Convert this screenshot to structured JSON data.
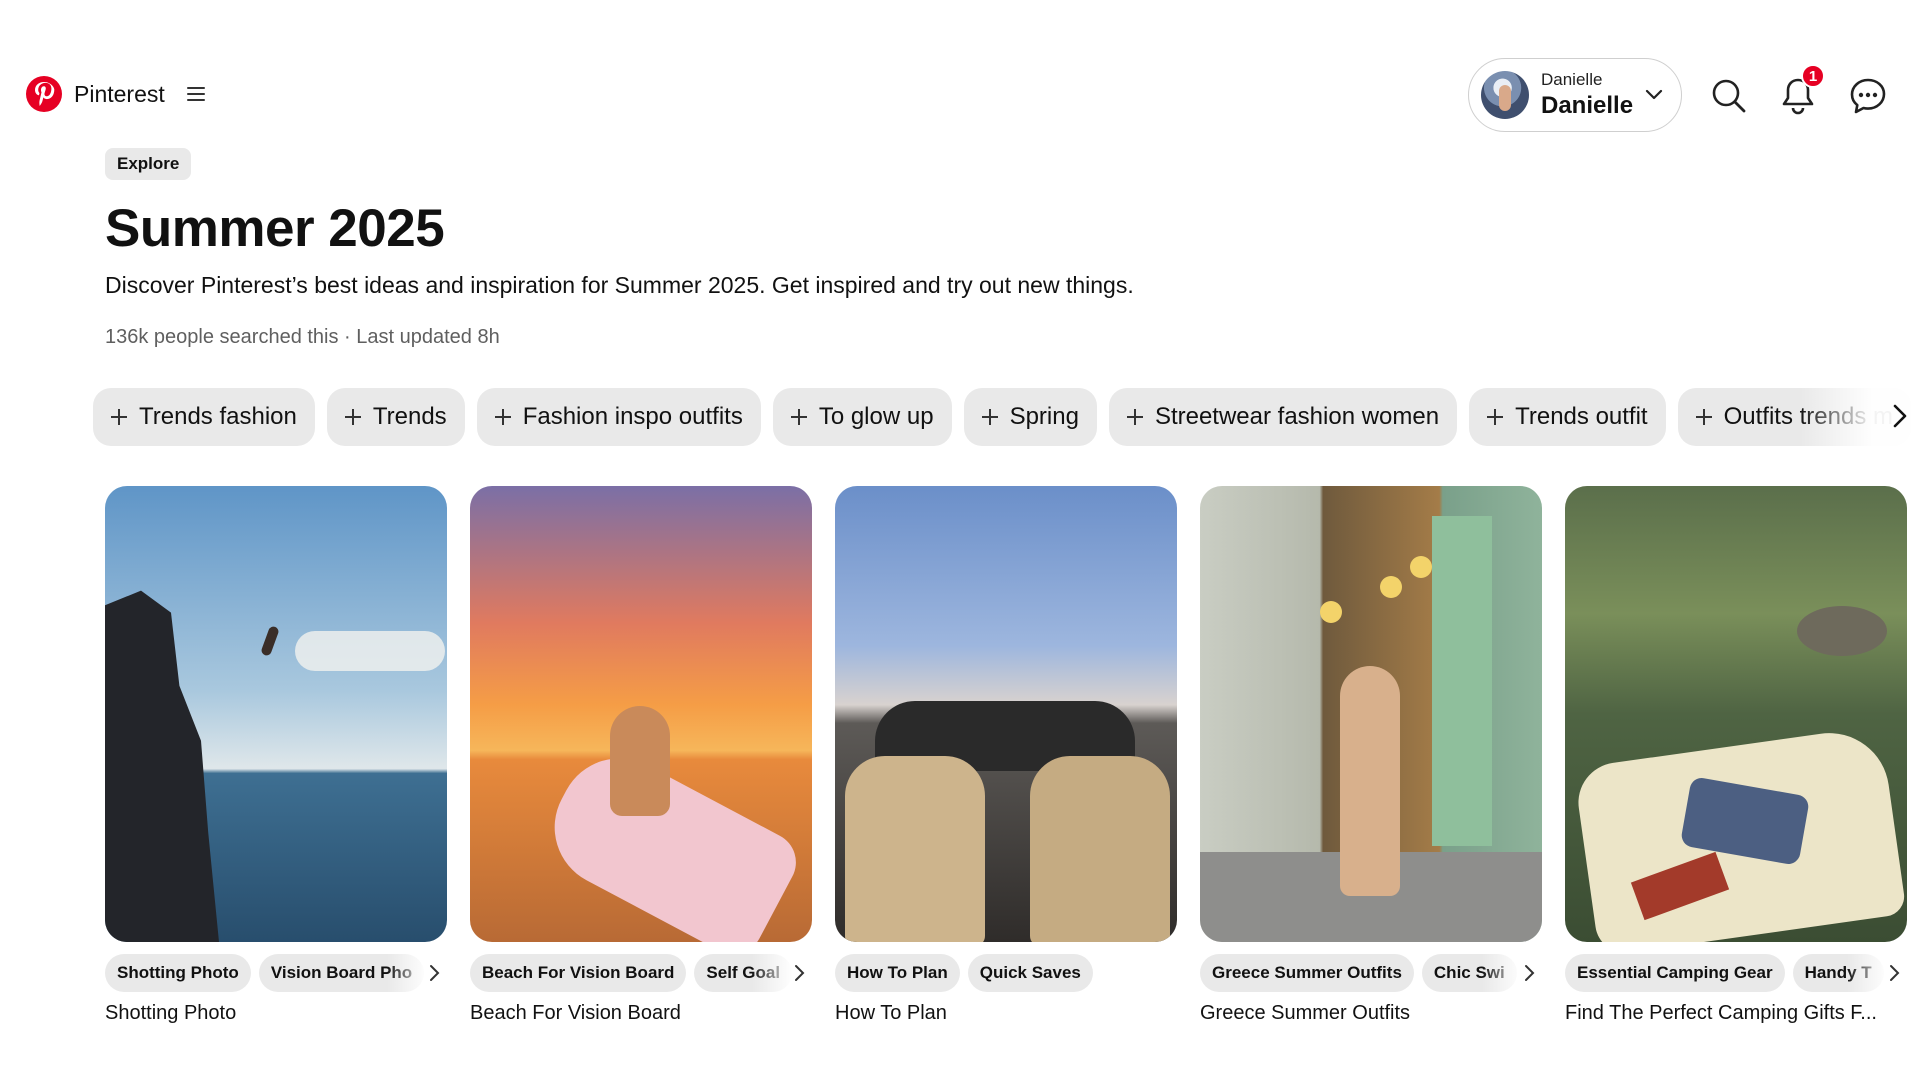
{
  "app": {
    "name": "Pinterest"
  },
  "account": {
    "label_small": "Danielle",
    "label_name": "Danielle"
  },
  "notifications": {
    "count": "1"
  },
  "page": {
    "breadcrumb": "Explore",
    "title": "Summer 2025",
    "description": "Discover Pinterest’s best ideas and inspiration for Summer 2025. Get inspired and try out new things.",
    "meta": "136k people searched this · Last updated 8h"
  },
  "filters": [
    "Trends fashion",
    "Trends",
    "Fashion inspo outfits",
    "To glow up",
    "Spring",
    "Streetwear fashion women",
    "Trends outfit",
    "Outfits trends m"
  ],
  "pins": [
    {
      "tags": [
        "Shotting Photo",
        "Vision Board Pho"
      ],
      "title": "Shotting Photo"
    },
    {
      "tags": [
        "Beach For Vision Board",
        "Self Goal"
      ],
      "title": "Beach For Vision Board"
    },
    {
      "tags": [
        "How To Plan",
        "Quick Saves"
      ],
      "title": "How To Plan"
    },
    {
      "tags": [
        "Greece Summer Outfits",
        "Chic Swi"
      ],
      "title": "Greece Summer Outfits"
    },
    {
      "tags": [
        "Essential Camping Gear",
        "Handy T"
      ],
      "title": "Find The Perfect Camping Gifts F..."
    }
  ],
  "icons": {
    "logo": "pinterest-logo",
    "menu": "hamburger-icon",
    "account_chevron": "chevron-down-icon",
    "search": "search-icon",
    "notifications": "bell-icon",
    "messages": "chat-icon",
    "scroll_next": "chevron-right-icon"
  },
  "colors": {
    "brand": "#e60023",
    "chip_bg": "#e9e9e9",
    "meta_text": "#5f5f5f"
  }
}
